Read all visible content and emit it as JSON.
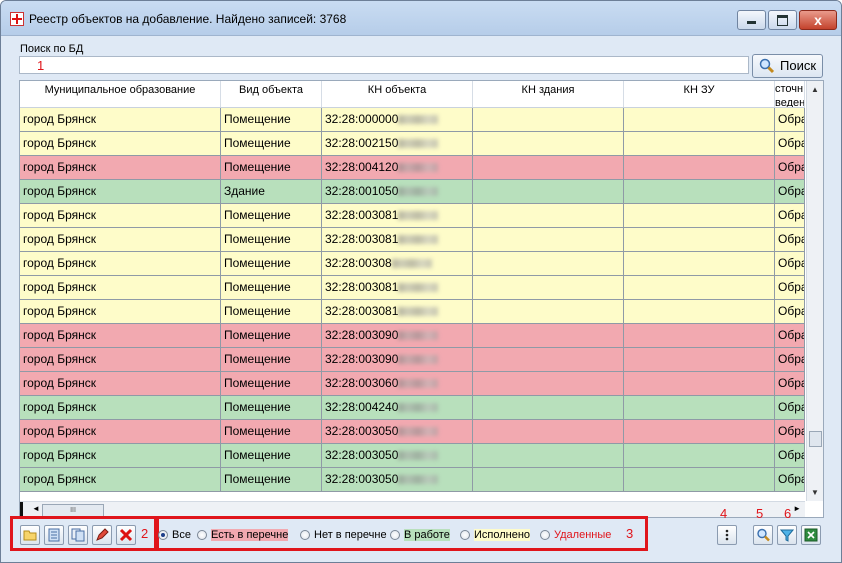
{
  "window": {
    "title": "Реестр объектов на добавление. Найдено записей: 3768",
    "close_glyph": "x"
  },
  "search": {
    "label": "Поиск по БД",
    "value": "",
    "button_label": "Поиск"
  },
  "annotations": [
    "1",
    "2",
    "3",
    "4",
    "5",
    "6"
  ],
  "grid": {
    "columns": [
      "Муниципальное образование",
      "Вид объекта",
      "КН объекта",
      "КН здания",
      "КН ЗУ",
      "сточн\nведен"
    ],
    "rows": [
      {
        "color": "yellow",
        "municipality": "город Брянск",
        "type": "Помещение",
        "kn": "32:28:000000",
        "kn_building": "",
        "kn_zu": "",
        "source": "Обра"
      },
      {
        "color": "yellow",
        "municipality": "город Брянск",
        "type": "Помещение",
        "kn": "32:28:002150",
        "kn_building": "",
        "kn_zu": "",
        "source": "Обра"
      },
      {
        "color": "red",
        "municipality": "город Брянск",
        "type": "Помещение",
        "kn": "32:28:004120",
        "kn_building": "",
        "kn_zu": "",
        "source": "Обра"
      },
      {
        "color": "green",
        "municipality": "город Брянск",
        "type": "Здание",
        "kn": "32:28:001050",
        "kn_building": "",
        "kn_zu": "",
        "source": "Обра"
      },
      {
        "color": "yellow",
        "municipality": "город Брянск",
        "type": "Помещение",
        "kn": "32:28:003081",
        "kn_building": "",
        "kn_zu": "",
        "source": "Обра"
      },
      {
        "color": "yellow",
        "municipality": "город Брянск",
        "type": "Помещение",
        "kn": "32:28:003081",
        "kn_building": "",
        "kn_zu": "",
        "source": "Обра"
      },
      {
        "color": "yellow",
        "municipality": "город Брянск",
        "type": "Помещение",
        "kn": "32:28:00308",
        "kn_building": "",
        "kn_zu": "",
        "source": "Обра"
      },
      {
        "color": "yellow",
        "municipality": "город Брянск",
        "type": "Помещение",
        "kn": "32:28:003081",
        "kn_building": "",
        "kn_zu": "",
        "source": "Обра"
      },
      {
        "color": "yellow",
        "municipality": "город Брянск",
        "type": "Помещение",
        "kn": "32:28:003081",
        "kn_building": "",
        "kn_zu": "",
        "source": "Обра"
      },
      {
        "color": "red",
        "municipality": "город Брянск",
        "type": "Помещение",
        "kn": "32:28:003090",
        "kn_building": "",
        "kn_zu": "",
        "source": "Обра"
      },
      {
        "color": "red",
        "municipality": "город Брянск",
        "type": "Помещение",
        "kn": "32:28:003090",
        "kn_building": "",
        "kn_zu": "",
        "source": "Обра"
      },
      {
        "color": "red",
        "municipality": "город Брянск",
        "type": "Помещение",
        "kn": "32:28:003060",
        "kn_building": "",
        "kn_zu": "",
        "source": "Обра"
      },
      {
        "color": "green",
        "municipality": "город Брянск",
        "type": "Помещение",
        "kn": "32:28:004240",
        "kn_building": "",
        "kn_zu": "",
        "source": "Обра"
      },
      {
        "color": "red",
        "municipality": "город Брянск",
        "type": "Помещение",
        "kn": "32:28:003050",
        "kn_building": "",
        "kn_zu": "",
        "source": "Обра"
      },
      {
        "color": "green",
        "municipality": "город Брянск",
        "type": "Помещение",
        "kn": "32:28:003050",
        "kn_building": "",
        "kn_zu": "",
        "source": "Обра"
      },
      {
        "color": "green",
        "municipality": "город Брянск",
        "type": "Помещение",
        "kn": "32:28:003050",
        "kn_building": "",
        "kn_zu": "",
        "source": "Обра"
      }
    ],
    "hscroll_thumb": "III"
  },
  "filters": {
    "options": [
      {
        "label": "Все",
        "selected": true,
        "style": "plain"
      },
      {
        "label": "Есть в перечне",
        "selected": false,
        "style": "red"
      },
      {
        "label": "Нет в перечне",
        "selected": false,
        "style": "plain"
      },
      {
        "label": "В работе",
        "selected": false,
        "style": "green"
      },
      {
        "label": "Исполнено",
        "selected": false,
        "style": "yellow"
      },
      {
        "label": "Удаленные",
        "selected": false,
        "style": "deleted"
      }
    ]
  },
  "colors": {
    "accent_red": "#e0151b",
    "row_yellow": "#fefcc9",
    "row_red": "#f2a9b0",
    "row_green": "#b8e0bc"
  },
  "icons": {
    "toolbar": [
      "open-folder-icon",
      "list-icon",
      "copy-icon",
      "edit-pencil-icon",
      "delete-icon"
    ],
    "right": [
      "more-vertical-icon",
      "search-icon",
      "filter-icon",
      "excel-icon"
    ]
  }
}
